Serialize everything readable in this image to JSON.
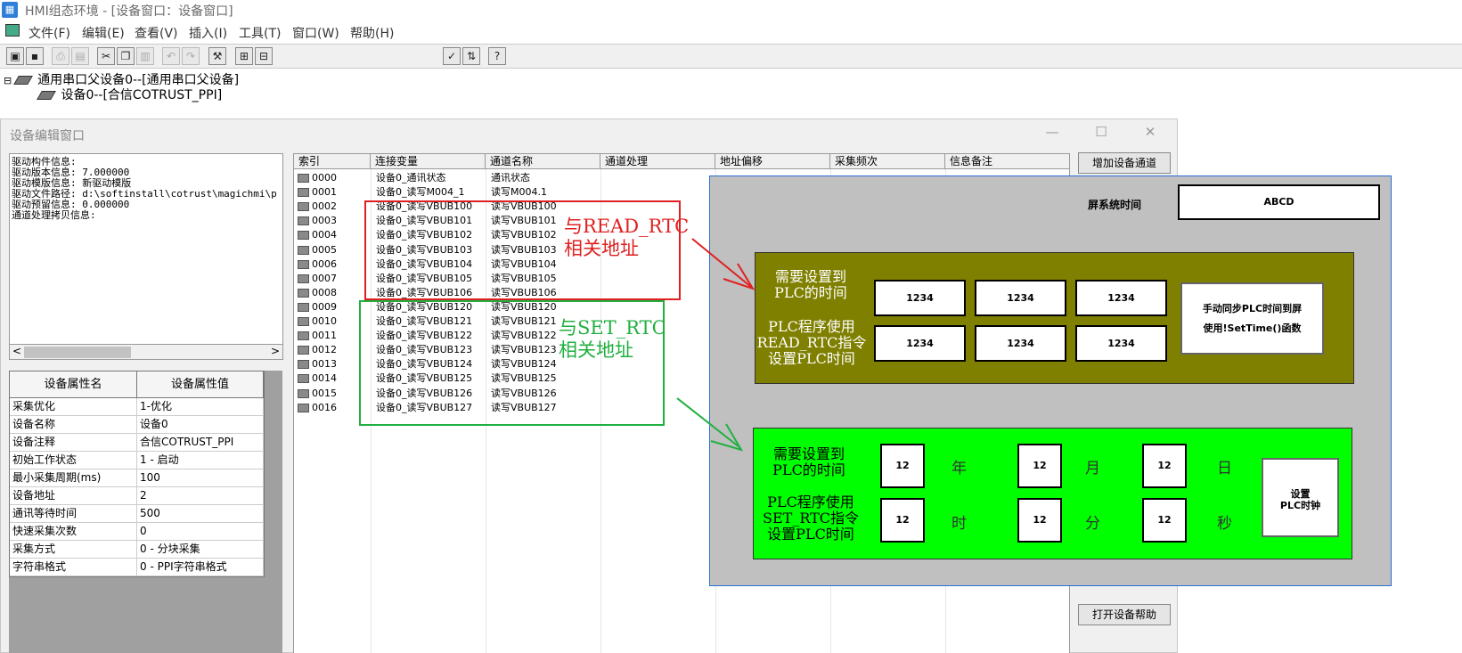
{
  "window": {
    "title": "HMI组态环境 - [设备窗口：设备窗口]",
    "icon": "app-icon"
  },
  "menu": [
    "文件(F)",
    "编辑(E)",
    "查看(V)",
    "插入(I)",
    "工具(T)",
    "窗口(W)",
    "帮助(H)"
  ],
  "toolbar_icons": [
    "new-window-icon",
    "save-icon",
    "print-icon",
    "print-preview-icon",
    "cut-icon",
    "copy-icon",
    "paste-icon",
    "undo-icon",
    "redo-icon",
    "tools-icon",
    "tree-expand-icon",
    "tree-collapse-icon",
    "check-icon",
    "sort-icon",
    "help-icon"
  ],
  "tree": {
    "parent": "通用串口父设备0--[通用串口父设备]",
    "child": "设备0--[合信COTRUST_PPI]"
  },
  "device_window": {
    "title": "设备编辑窗口",
    "controls": {
      "minimize": "—",
      "maximize": "☐",
      "close": "✕"
    },
    "info_lines": [
      "驱动构件信息:",
      "驱动版本信息: 7.000000",
      "驱动模版信息: 新驱动模版",
      "驱动文件路径: d:\\softinstall\\cotrust\\magichmi\\p",
      "驱动预留信息: 0.000000",
      "通道处理拷贝信息:"
    ],
    "scroll_left": "<",
    "scroll_right": ">",
    "prop_headers": [
      "设备属性名",
      "设备属性值"
    ],
    "props": [
      [
        "采集优化",
        "1-优化"
      ],
      [
        "设备名称",
        "设备0"
      ],
      [
        "设备注释",
        "合信COTRUST_PPI"
      ],
      [
        "初始工作状态",
        "1 - 启动"
      ],
      [
        "最小采集周期(ms)",
        "100"
      ],
      [
        "设备地址",
        "2"
      ],
      [
        "通讯等待时间",
        "500"
      ],
      [
        "快速采集次数",
        "0"
      ],
      [
        "采集方式",
        "0 - 分块采集"
      ],
      [
        "字符串格式",
        "0 - PPI字符串格式"
      ]
    ],
    "channel_headers": [
      "索引",
      "连接变量",
      "通道名称",
      "通道处理",
      "地址偏移",
      "采集频次",
      "信息备注"
    ],
    "channels": [
      [
        "0000",
        "设备0_通讯状态",
        "通讯状态"
      ],
      [
        "0001",
        "设备0_读写M004_1",
        "读写M004.1"
      ],
      [
        "0002",
        "设备0_读写VBUB100",
        "读写VBUB100"
      ],
      [
        "0003",
        "设备0_读写VBUB101",
        "读写VBUB101"
      ],
      [
        "0004",
        "设备0_读写VBUB102",
        "读写VBUB102"
      ],
      [
        "0005",
        "设备0_读写VBUB103",
        "读写VBUB103"
      ],
      [
        "0006",
        "设备0_读写VBUB104",
        "读写VBUB104"
      ],
      [
        "0007",
        "设备0_读写VBUB105",
        "读写VBUB105"
      ],
      [
        "0008",
        "设备0_读写VBUB106",
        "读写VBUB106"
      ],
      [
        "0009",
        "设备0_读写VBUB120",
        "读写VBUB120"
      ],
      [
        "0010",
        "设备0_读写VBUB121",
        "读写VBUB121"
      ],
      [
        "0011",
        "设备0_读写VBUB122",
        "读写VBUB122"
      ],
      [
        "0012",
        "设备0_读写VBUB123",
        "读写VBUB123"
      ],
      [
        "0013",
        "设备0_读写VBUB124",
        "读写VBUB124"
      ],
      [
        "0014",
        "设备0_读写VBUB125",
        "读写VBUB125"
      ],
      [
        "0015",
        "设备0_读写VBUB126",
        "读写VBUB126"
      ],
      [
        "0016",
        "设备0_读写VBUB127",
        "读写VBUB127"
      ]
    ],
    "buttons": {
      "add_channel": "增加设备通道",
      "open_help": "打开设备帮助"
    }
  },
  "annotations": {
    "read_rtc": [
      "与READ_RTC",
      "相关地址"
    ],
    "set_rtc": [
      "与SET_RTC",
      "相关地址"
    ],
    "red": "#e02020",
    "green": "#20b040"
  },
  "hmi": {
    "screen_time_label": "屏系统时间",
    "screen_time_value": "ABCD",
    "olive": {
      "color": "#7f7f00",
      "need_set": [
        "需要设置到",
        "PLC的时间"
      ],
      "plc_use": [
        "PLC程序使用",
        "READ_RTC指令",
        "设置PLC时间"
      ],
      "values": [
        "1234",
        "1234",
        "1234",
        "1234",
        "1234",
        "1234"
      ],
      "sync_button": [
        "手动同步PLC时间到屏",
        "使用!SetTime()函数"
      ]
    },
    "green": {
      "color": "#00ff00",
      "need_set": [
        "需要设置到",
        "PLC的时间"
      ],
      "plc_use": [
        "PLC程序使用",
        "SET_RTC指令",
        "设置PLC时间"
      ],
      "values": [
        "12",
        "12",
        "12",
        "12",
        "12",
        "12"
      ],
      "units": [
        "年",
        "月",
        "日",
        "时",
        "分",
        "秒"
      ],
      "set_button": [
        "设置",
        "PLC时钟"
      ]
    }
  }
}
